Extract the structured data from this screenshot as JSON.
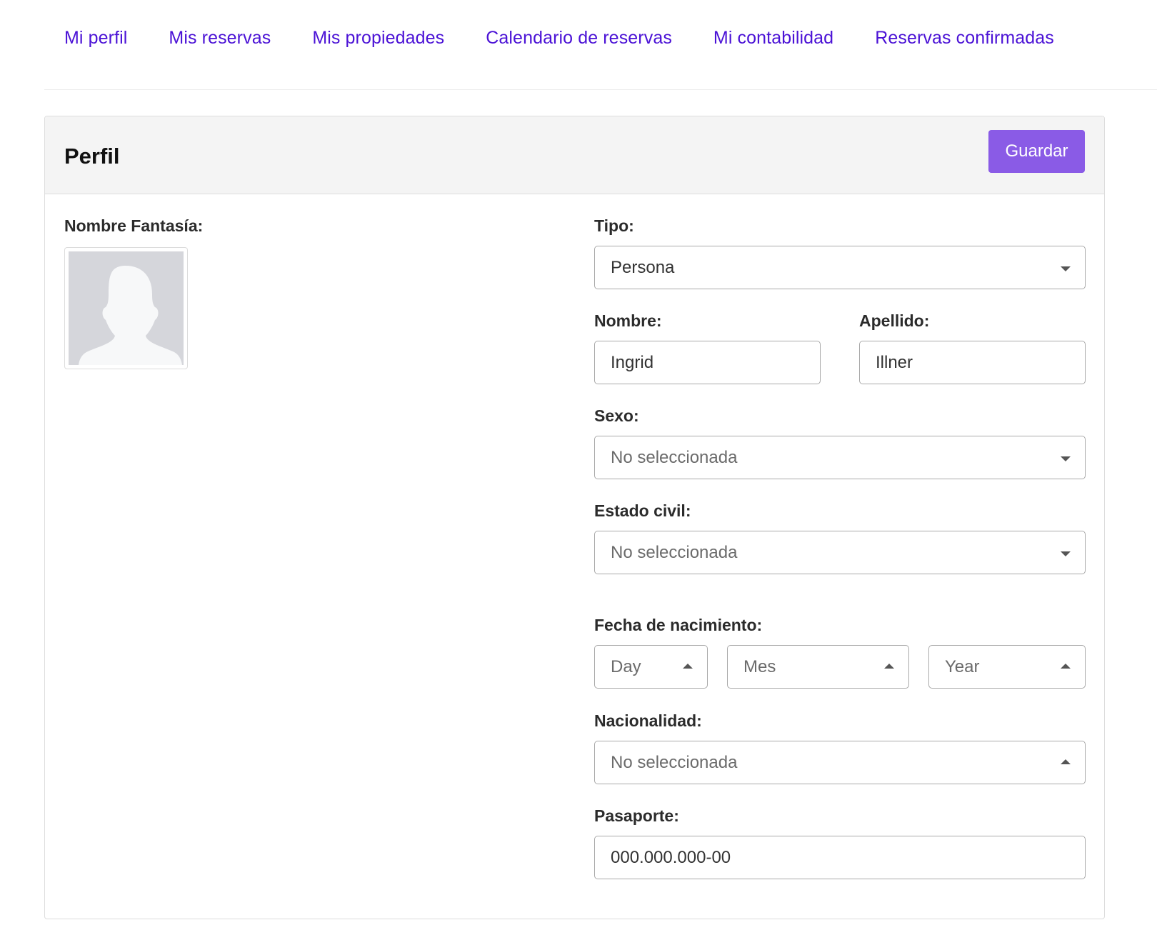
{
  "nav": {
    "items": [
      "Mi perfil",
      "Mis reservas",
      "Mis propiedades",
      "Calendario de reservas",
      "Mi contabilidad",
      "Reservas confirmadas"
    ]
  },
  "card": {
    "title": "Perfil",
    "save_label": "Guardar"
  },
  "form": {
    "nombre_fantasia_label": "Nombre Fantasía:",
    "tipo": {
      "label": "Tipo:",
      "value": "Persona"
    },
    "nombre": {
      "label": "Nombre:",
      "value": "Ingrid"
    },
    "apellido": {
      "label": "Apellido:",
      "value": "Illner"
    },
    "sexo": {
      "label": "Sexo:",
      "value": "No seleccionada"
    },
    "estado_civil": {
      "label": "Estado civil:",
      "value": "No seleccionada"
    },
    "fecha_nacimiento": {
      "label": "Fecha de nacimiento:",
      "day": "Day",
      "month": "Mes",
      "year": "Year"
    },
    "nacionalidad": {
      "label": "Nacionalidad:",
      "value": "No seleccionada"
    },
    "pasaporte": {
      "label": "Pasaporte:",
      "value": "000.000.000-00"
    }
  },
  "colors": {
    "nav_link": "#4b12d6",
    "primary_button": "#8a5be6",
    "header_bg": "#f4f4f4"
  }
}
